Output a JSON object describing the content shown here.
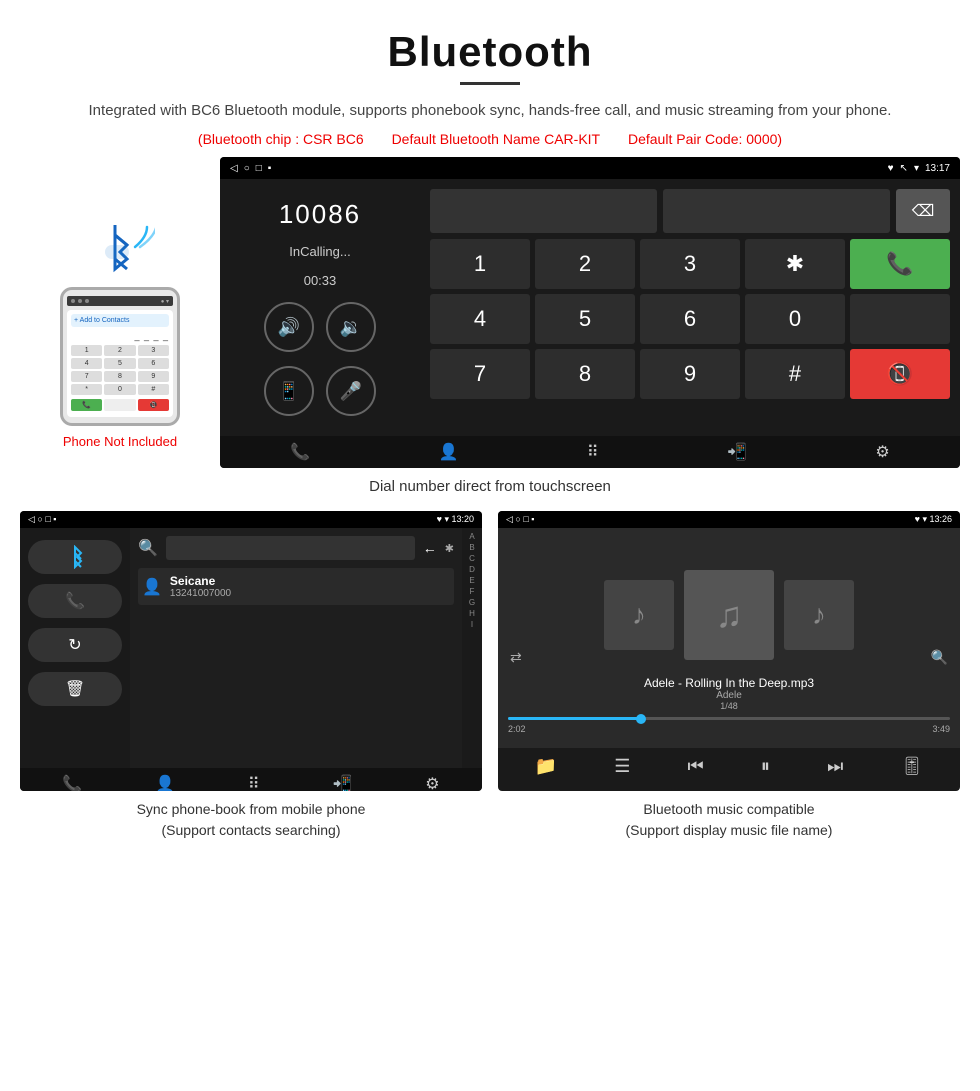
{
  "header": {
    "title": "Bluetooth",
    "description": "Integrated with BC6 Bluetooth module, supports phonebook sync, hands-free call, and music streaming from your phone.",
    "spec_chip": "(Bluetooth chip : CSR BC6",
    "spec_name": "Default Bluetooth Name CAR-KIT",
    "spec_code": "Default Pair Code: 0000)"
  },
  "dialer": {
    "statusbar_left": "◁   ○   □   ▪",
    "statusbar_right": "♥ ↖ ▾ 13:17",
    "number": "10086",
    "status": "InCalling...",
    "timer": "00:33",
    "keys": [
      "1",
      "2",
      "3",
      "*",
      "",
      "4",
      "5",
      "6",
      "0",
      "",
      "7",
      "8",
      "9",
      "#",
      ""
    ],
    "caption": "Dial number direct from touchscreen"
  },
  "phonebook": {
    "statusbar_left": "◁   ○   □   ▪",
    "statusbar_right": "♥ ▾ 13:20",
    "contact_name": "Seicane",
    "contact_number": "13241007000",
    "alpha_letters": [
      "A",
      "B",
      "C",
      "D",
      "E",
      "F",
      "G",
      "H",
      "I"
    ],
    "caption_line1": "Sync phone-book from mobile phone",
    "caption_line2": "(Support contacts searching)"
  },
  "music": {
    "statusbar_left": "◁   ○   □   ▪",
    "statusbar_right": "♥ ▾ 13:26",
    "song_title": "Adele - Rolling In the Deep.mp3",
    "artist": "Adele",
    "track": "1/48",
    "time_current": "2:02",
    "time_total": "3:49",
    "progress_pct": 30,
    "caption_line1": "Bluetooth music compatible",
    "caption_line2": "(Support display music file name)"
  },
  "phone_label": "Phone Not Included"
}
